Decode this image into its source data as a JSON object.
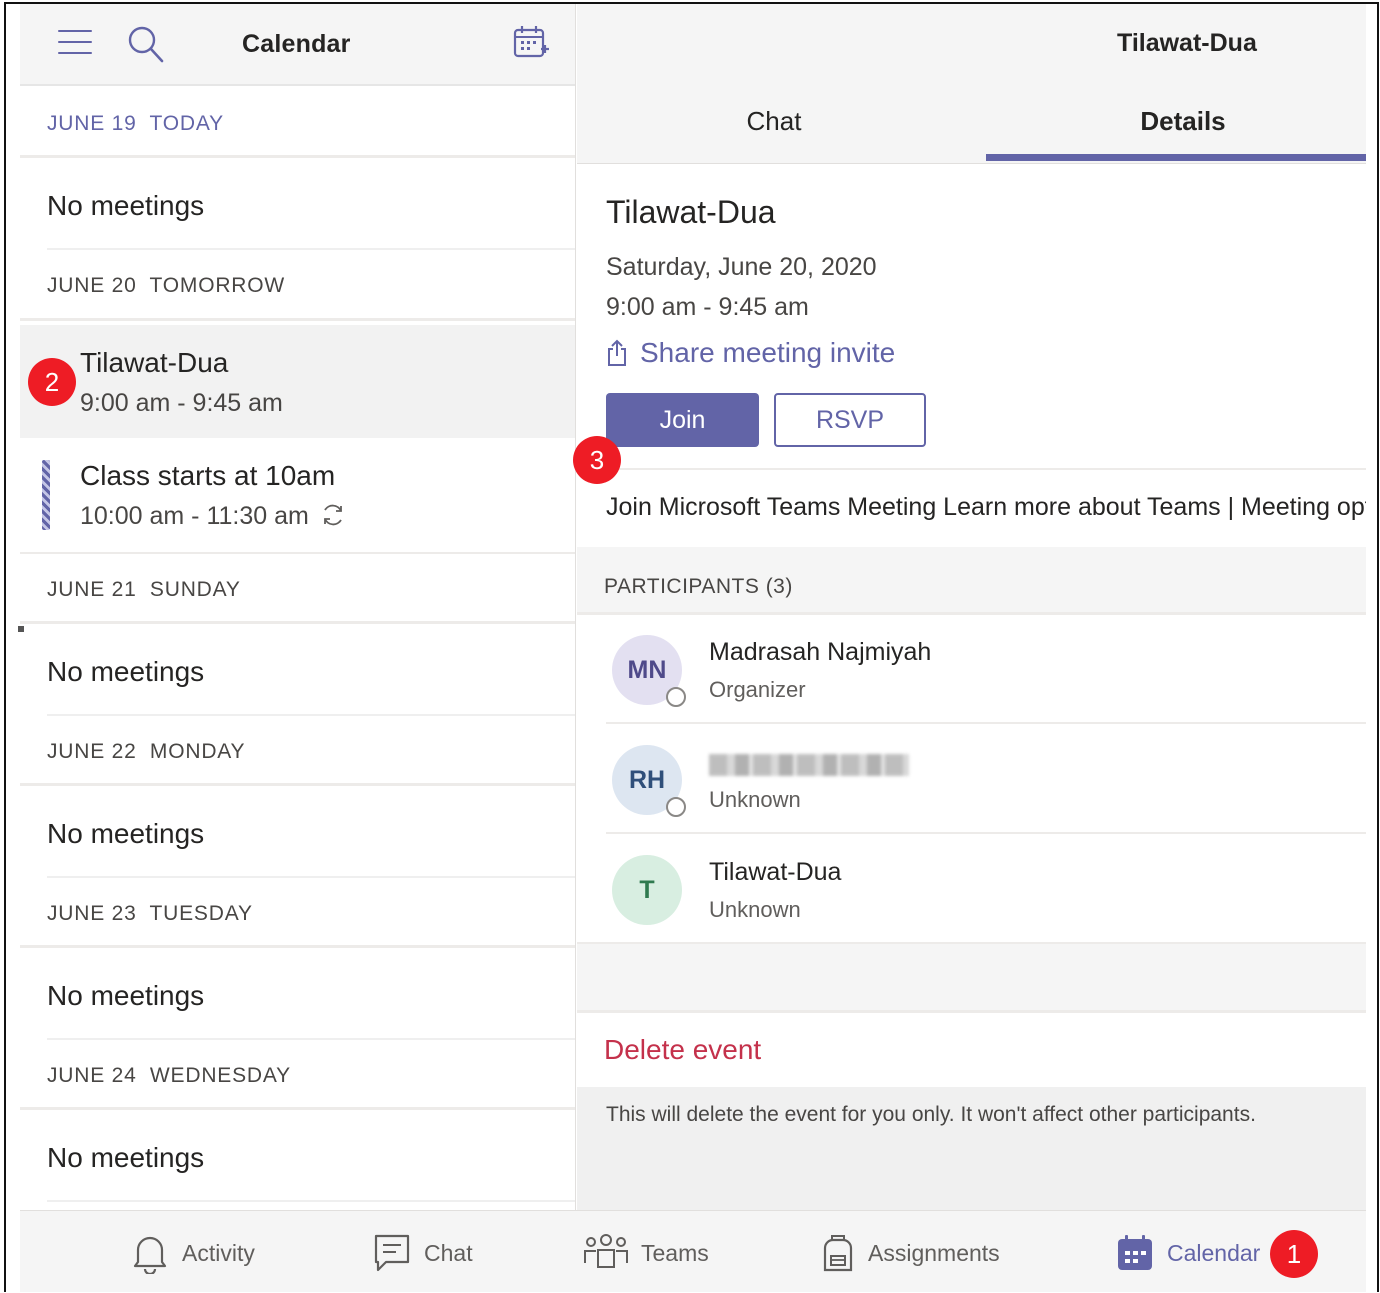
{
  "left_header": {
    "title": "Calendar"
  },
  "agenda": {
    "days": [
      {
        "date": "JUNE 19",
        "label": "TODAY",
        "empty_text": "No meetings"
      },
      {
        "date": "JUNE 20",
        "label": "TOMORROW"
      },
      {
        "date": "JUNE 21",
        "label": "SUNDAY",
        "empty_text": "No meetings"
      },
      {
        "date": "JUNE 22",
        "label": "MONDAY",
        "empty_text": "No meetings"
      },
      {
        "date": "JUNE 23",
        "label": "TUESDAY",
        "empty_text": "No meetings"
      },
      {
        "date": "JUNE 24",
        "label": "WEDNESDAY",
        "empty_text": "No meetings"
      }
    ],
    "events": [
      {
        "title": "Tilawat-Dua",
        "time": "9:00 am - 9:45 am",
        "selected": true
      },
      {
        "title": "Class starts at 10am",
        "time": "10:00 am - 11:30 am",
        "recurring": true
      }
    ]
  },
  "right_header": {
    "title": "Tilawat-Dua"
  },
  "tabs": [
    {
      "label": "Chat",
      "active": false
    },
    {
      "label": "Details",
      "active": true
    }
  ],
  "details": {
    "title": "Tilawat-Dua",
    "date": "Saturday, June 20, 2020",
    "time": "9:00 am - 9:45 am",
    "share_label": "Share meeting invite",
    "join_label": "Join",
    "rsvp_label": "RSVP",
    "description": "Join Microsoft Teams Meeting Learn more about Teams | Meeting options",
    "participants_label": "PARTICIPANTS (3)",
    "participants": [
      {
        "initials": "MN",
        "name": "Madrasah Najmiyah",
        "role": "Organizer",
        "avatar_bg": "#e3e0f1",
        "avatar_fg": "#4f4a8a"
      },
      {
        "initials": "RH",
        "name": "",
        "role": "Unknown",
        "name_redacted": true,
        "avatar_bg": "#dde6f1",
        "avatar_fg": "#2f4f7a"
      },
      {
        "initials": "T",
        "name": "Tilawat-Dua",
        "role": "Unknown",
        "avatar_bg": "#d8eee1",
        "avatar_fg": "#2f7a4f"
      }
    ],
    "delete_label": "Delete event",
    "delete_note": "This will delete the event for you only. It won't affect other participants."
  },
  "bottom_nav": [
    {
      "label": "Activity",
      "icon": "bell-icon",
      "active": false
    },
    {
      "label": "Chat",
      "icon": "chat-icon",
      "active": false
    },
    {
      "label": "Teams",
      "icon": "teams-icon",
      "active": false
    },
    {
      "label": "Assignments",
      "icon": "backpack-icon",
      "active": false
    },
    {
      "label": "Calendar",
      "icon": "calendar-icon",
      "active": true
    }
  ],
  "annotations": [
    "1",
    "2",
    "3"
  ],
  "colors": {
    "accent": "#6264a7",
    "danger": "#c4314b",
    "badge": "#ee1c25"
  }
}
